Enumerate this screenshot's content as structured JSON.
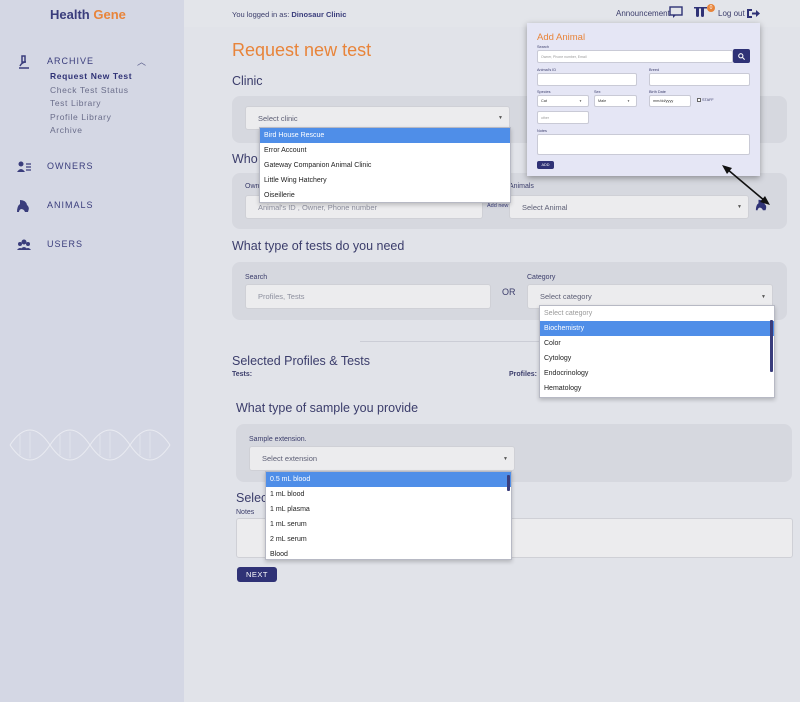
{
  "brand": {
    "part1": "Health",
    "part2": "Gene"
  },
  "sidebar": {
    "archive": {
      "label": "ARCHIVE",
      "icon": "microscope-icon",
      "expanded_icon": "chevron-up-icon"
    },
    "archive_items": [
      "Request New Test",
      "Check Test Status",
      "Test Library",
      "Profile Library",
      "Archive"
    ],
    "owners": {
      "label": "OWNERS",
      "icon": "owners-icon"
    },
    "animals": {
      "label": "ANIMALS",
      "icon": "animal-icon"
    },
    "users": {
      "label": "USERS",
      "icon": "users-icon"
    }
  },
  "topbar": {
    "logged_prefix": "You logged in as:",
    "logged_user": "Dinosaur Clinic",
    "announcement": "Announcement",
    "badge": "0",
    "logout": "Log out"
  },
  "page": {
    "title": "Request new test",
    "clinic_heading": "Clinic",
    "who_heading": "Who",
    "tests_heading": "What type of tests do you need",
    "selected_heading": "Selected Profiles & Tests",
    "sample_heading": "What type of sample you provide",
    "selec_heading": "Selec"
  },
  "clinic": {
    "placeholder": "Select clinic",
    "options": [
      "Bird House Rescue",
      "Error Account",
      "Gateway Companion Animal Clinic",
      "Little Wing Hatchery",
      "Oiseillerie"
    ],
    "selected_index": 0
  },
  "owner": {
    "label": "Own",
    "placeholder": "Animal's ID , Owner, Phone number",
    "add_new": "Add new"
  },
  "animals": {
    "label": "Animals",
    "placeholder": "Select Animal"
  },
  "tests": {
    "search_label": "Search",
    "search_placeholder": "Profiles, Tests",
    "or": "OR",
    "category_label": "Category",
    "category_value": "Select category",
    "category_options": [
      "Select category",
      "Biochemistry",
      "Color",
      "Cytology",
      "Endocrinology",
      "Hematology"
    ],
    "selected_index": 1
  },
  "selected": {
    "tests_label": "Tests:",
    "profiles_label": "Profiles:"
  },
  "sample": {
    "label": "Sample extension.",
    "placeholder": "Select extension",
    "options": [
      "0.5 mL blood",
      "1 mL blood",
      "1 mL plasma",
      "1 mL serum",
      "2 mL serum",
      "Blood"
    ],
    "selected_index": 0
  },
  "notes": {
    "label": "Notes"
  },
  "next_button": "NEXT",
  "modal": {
    "title": "Add Animal",
    "search_label": "Search",
    "search_placeholder": "Owner, Phone number, Email",
    "animal_id_label": "Animal's ID",
    "breed_label": "Breed",
    "species_label": "Species",
    "species_value": "Cat",
    "sex_label": "Sex",
    "sex_value": "Male",
    "birth_label": "Birth Date",
    "birth_value": "mm/dd/yyyy",
    "staff_label": "STAFF",
    "other_placeholder": "other",
    "notes_label": "Notes",
    "add_button": "ADD"
  },
  "colors": {
    "accent": "#e8843a",
    "brand": "#2f3276",
    "selected": "#4f8ee8"
  }
}
